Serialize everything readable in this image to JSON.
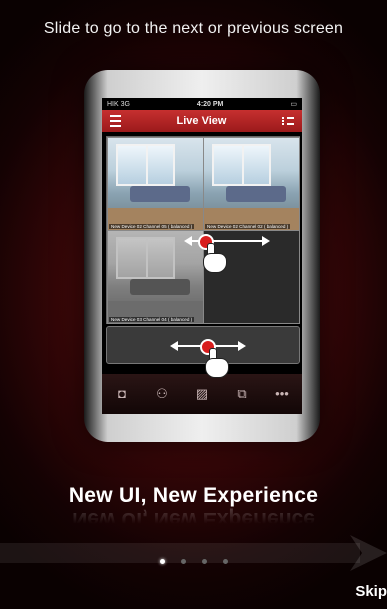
{
  "instruction": "Slide to go to the next or previous screen",
  "phone": {
    "status": {
      "carrier": "HIK 3G",
      "time": "4:20 PM"
    },
    "title": "Live View",
    "tiles": [
      {
        "caption": "New Device 02 Channel 05 ( balanced )"
      },
      {
        "caption": "New Device 02 Channel 02 ( balanced )"
      },
      {
        "caption": "New Device 03 Channel 04 ( balanced )"
      }
    ],
    "toolbar_icons": [
      "camera-icon",
      "ptz-icon",
      "image-quality-icon",
      "copy-icon",
      "more-icon"
    ],
    "toolbar_glyphs": {
      "camera": "◘",
      "ptz": "⚇",
      "quality": "▨",
      "copy": "⧉",
      "more": "•••"
    }
  },
  "headline": "New UI, New Experience",
  "pagination": {
    "total": 4,
    "active": 0
  },
  "skip_label": "Skip",
  "colors": {
    "accent": "#c6302f",
    "background": "#3a0708"
  }
}
